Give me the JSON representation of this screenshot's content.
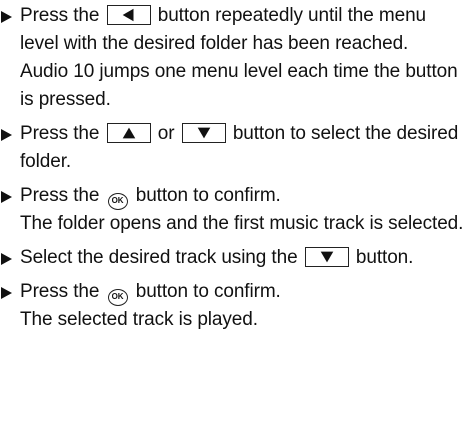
{
  "steps": [
    {
      "before": "Press the",
      "key1": "left-arrow-key",
      "after": "button repeatedly until the menu level with the desired folder has been reached.",
      "result": "Audio 10 jumps one menu level each time the button is pressed."
    },
    {
      "before": "Press the",
      "key1": "up-arrow-key",
      "middle": "or",
      "key2": "down-arrow-key",
      "after": "button to select the desired folder."
    },
    {
      "before": "Press the",
      "ok": "OK",
      "after": "button to confirm.",
      "result": "The folder opens and the first music track is selected."
    },
    {
      "before": "Select the desired track using the",
      "key1": "down-arrow-key",
      "after": "button."
    },
    {
      "before": "Press the",
      "ok": "OK",
      "after": "button to confirm.",
      "result": "The selected track is played."
    }
  ]
}
